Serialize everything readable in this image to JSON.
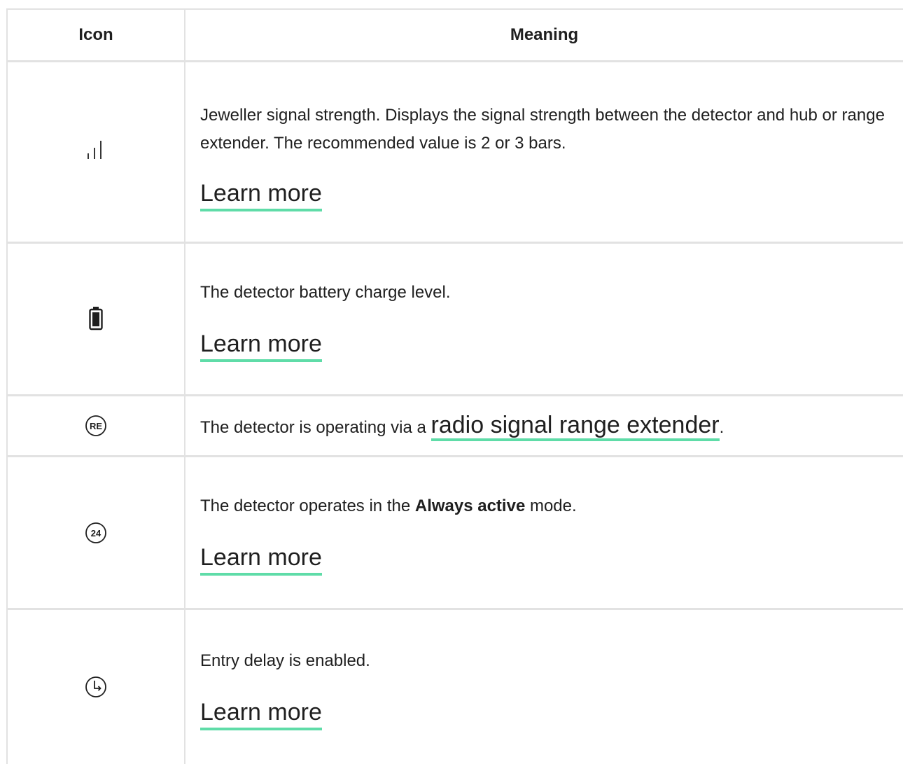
{
  "header": {
    "icon_col": "Icon",
    "meaning_col": "Meaning"
  },
  "rows": [
    {
      "icon": "signal-strength-icon",
      "text": "Jeweller signal strength. Displays the signal strength between the detector and hub or range extender. The recommended value is 2 or 3 bars.",
      "link": "Learn more"
    },
    {
      "icon": "battery-icon",
      "text": "The detector battery charge level.",
      "link": "Learn more"
    },
    {
      "icon": "range-extender-icon",
      "icon_text": "RE",
      "text_before": "The detector is operating via a ",
      "link": "radio signal range extender",
      "text_after": "."
    },
    {
      "icon": "always-active-icon",
      "icon_text": "24",
      "text_before": "The detector operates in the ",
      "text_bold": "Always active",
      "text_after": " mode.",
      "link": "Learn more"
    },
    {
      "icon": "entry-delay-icon",
      "text": "Entry delay is enabled.",
      "link": "Learn more"
    }
  ],
  "colors": {
    "link_underline": "#5fdca8",
    "border": "#e2e2e2",
    "text": "#1f1f1f"
  }
}
